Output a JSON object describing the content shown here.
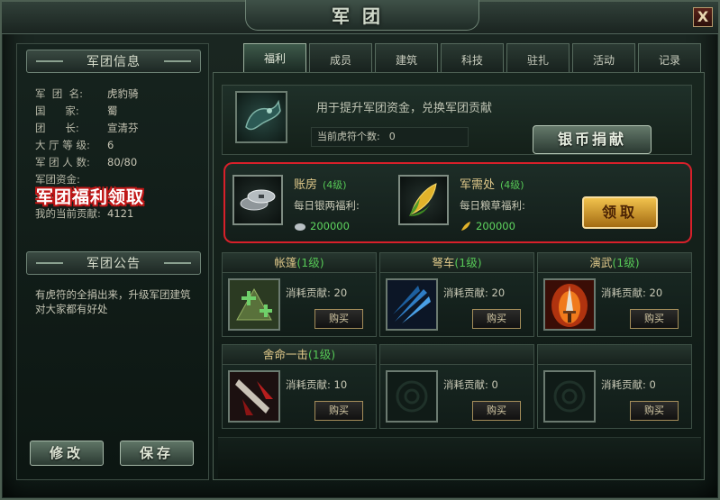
{
  "window": {
    "title": "军团",
    "close_label": "X"
  },
  "tabs": [
    {
      "label": "福利",
      "active": true
    },
    {
      "label": "成员",
      "active": false
    },
    {
      "label": "建筑",
      "active": false
    },
    {
      "label": "科技",
      "active": false
    },
    {
      "label": "驻扎",
      "active": false
    },
    {
      "label": "活动",
      "active": false
    },
    {
      "label": "记录",
      "active": false
    }
  ],
  "legion_info": {
    "header": "军团信息",
    "rows": [
      {
        "key": "军  团  名:",
        "value": "虎豹骑"
      },
      {
        "key": "国      家:",
        "value": "蜀"
      },
      {
        "key": "团      长:",
        "value": "宣清芬"
      },
      {
        "key": "大 厅 等 级:",
        "value": "6"
      },
      {
        "key": "军 团 人 数:",
        "value": "80/80"
      },
      {
        "key": "军团资金:",
        "value": ""
      },
      {
        "key": "我的总贡献:",
        "value": "4121"
      },
      {
        "key": "我的当前贡献:",
        "value": "4121"
      }
    ]
  },
  "overlay_label": "军团福利领取",
  "notice": {
    "header": "军团公告",
    "text": "有虎符的全捐出来，升级军团建筑对大家都有好处"
  },
  "left_buttons": {
    "modify": "修改",
    "save": "保存"
  },
  "promo": {
    "description": "用于提升军团资金，兑换军团贡献",
    "count_label": "当前虎符个数:",
    "count_value": "0",
    "donate_button": "银币捐献"
  },
  "welfare": [
    {
      "title": "账房",
      "level": "(4级)",
      "subtitle": "每日银两福利:",
      "amount": "200000",
      "icon": "silver-coins-icon"
    },
    {
      "title": "军需处",
      "level": "(4级)",
      "subtitle": "每日粮草福利:",
      "amount": "200000",
      "icon": "corn-icon"
    }
  ],
  "claim_button": "领取",
  "shop": [
    {
      "title": "帐篷",
      "level": "(1级)",
      "cost_label": "消耗贡献:",
      "cost": "20",
      "buy": "购买",
      "icon": "tent-heal-icon"
    },
    {
      "title": "弩车",
      "level": "(1级)",
      "cost_label": "消耗贡献:",
      "cost": "20",
      "buy": "购买",
      "icon": "arrows-icon"
    },
    {
      "title": "演武",
      "level": "(1级)",
      "cost_label": "消耗贡献:",
      "cost": "20",
      "buy": "购买",
      "icon": "sword-fire-icon"
    },
    {
      "title": "舍命一击",
      "level": "(1级)",
      "cost_label": "消耗贡献:",
      "cost": "10",
      "buy": "购买",
      "icon": "strike-icon"
    },
    {
      "title": "",
      "level": "",
      "cost_label": "消耗贡献:",
      "cost": "0",
      "buy": "购买",
      "icon": "empty-slot-icon"
    },
    {
      "title": "",
      "level": "",
      "cost_label": "消耗贡献:",
      "cost": "0",
      "buy": "购买",
      "icon": "empty-slot-icon"
    }
  ],
  "colors": {
    "highlight_border": "#d8202a",
    "level_green": "#56c856",
    "gold_text": "#e0c98a"
  }
}
